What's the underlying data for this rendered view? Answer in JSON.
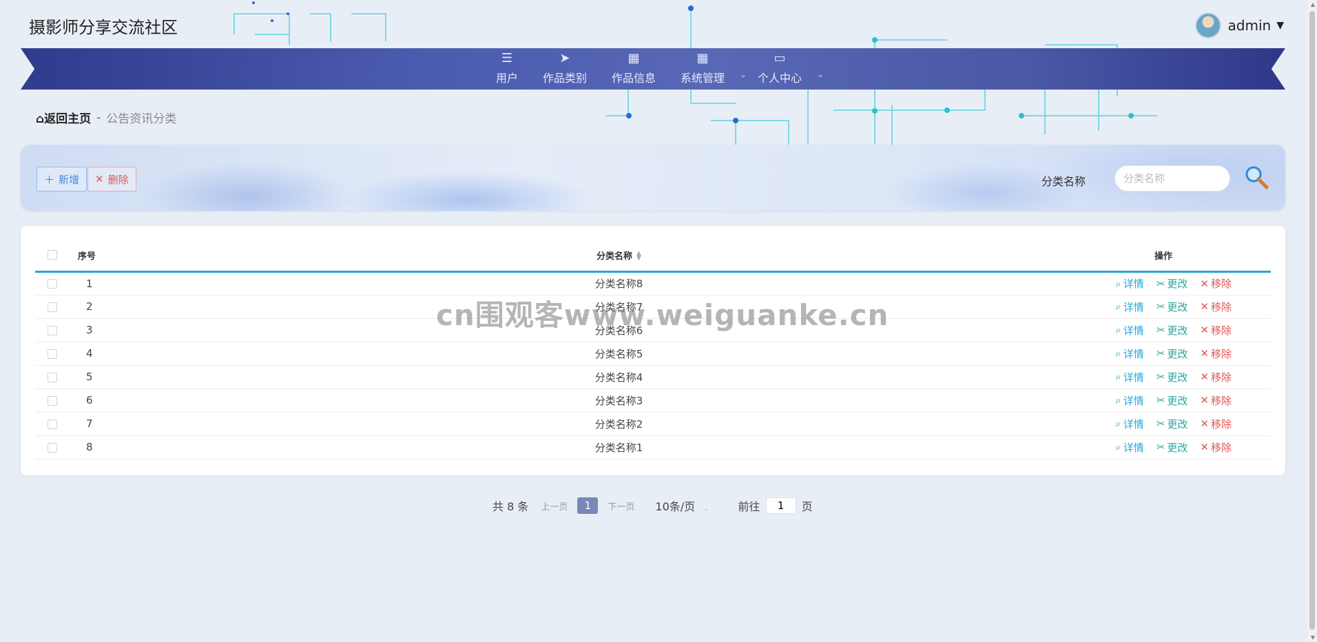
{
  "header": {
    "site_title": "摄影师分享交流社区",
    "username": "admin"
  },
  "nav": {
    "items": [
      {
        "label": "用户",
        "icon": "list-icon"
      },
      {
        "label": "作品类别",
        "icon": "paper-plane-icon"
      },
      {
        "label": "作品信息",
        "icon": "grid-icon"
      },
      {
        "label": "系统管理",
        "icon": "grid-icon"
      },
      {
        "label": "个人中心",
        "icon": "wallet-icon"
      }
    ]
  },
  "breadcrumb": {
    "home": "返回主页",
    "separator": "-",
    "current": "公告资讯分类"
  },
  "toolbar": {
    "add_label": "新增",
    "delete_label": "删除",
    "search_label": "分类名称",
    "search_placeholder": "分类名称"
  },
  "table": {
    "headers": {
      "index": "序号",
      "name": "分类名称",
      "ops": "操作"
    },
    "op_labels": {
      "detail": "详情",
      "edit": "更改",
      "remove": "移除"
    },
    "rows": [
      {
        "index": "1",
        "name": "分类名称8"
      },
      {
        "index": "2",
        "name": "分类名称7"
      },
      {
        "index": "3",
        "name": "分类名称6"
      },
      {
        "index": "4",
        "name": "分类名称5"
      },
      {
        "index": "5",
        "name": "分类名称4"
      },
      {
        "index": "6",
        "name": "分类名称3"
      },
      {
        "index": "7",
        "name": "分类名称2"
      },
      {
        "index": "8",
        "name": "分类名称1"
      }
    ]
  },
  "watermark": "cn围观客www.weiguanke.cn",
  "pagination": {
    "total": "共 8 条",
    "prev": "上一页",
    "current_page": "1",
    "next": "下一页",
    "page_size": "10条/页",
    "goto_label": "前往",
    "goto_value": "1",
    "page_suffix": "页"
  },
  "colors": {
    "nav_bg": "#4a5aae",
    "accent": "#2aa6d8",
    "danger": "#e05555",
    "edit": "#2aa6a0"
  }
}
